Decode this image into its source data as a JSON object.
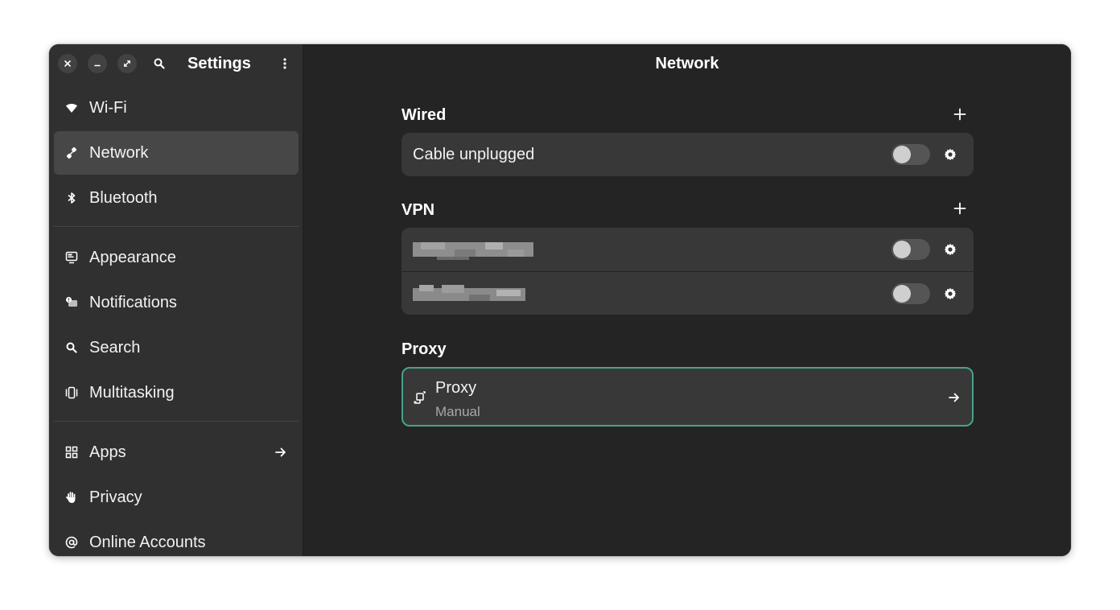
{
  "sidebar": {
    "title": "Settings",
    "items": [
      {
        "label": "Wi-Fi",
        "icon": "wifi-icon"
      },
      {
        "label": "Network",
        "icon": "network-icon",
        "active": true
      },
      {
        "label": "Bluetooth",
        "icon": "bluetooth-icon"
      },
      {
        "label": "Appearance",
        "icon": "appearance-icon"
      },
      {
        "label": "Notifications",
        "icon": "notifications-icon"
      },
      {
        "label": "Search",
        "icon": "search-icon"
      },
      {
        "label": "Multitasking",
        "icon": "multitasking-icon"
      },
      {
        "label": "Apps",
        "icon": "apps-icon"
      },
      {
        "label": "Privacy",
        "icon": "privacy-hand-icon"
      },
      {
        "label": "Online Accounts",
        "icon": "at-sign-icon"
      }
    ]
  },
  "main": {
    "title": "Network",
    "wired": {
      "label": "Wired",
      "rows": [
        {
          "label": "Cable unplugged",
          "enabled": false
        }
      ]
    },
    "vpn": {
      "label": "VPN",
      "rows": [
        {
          "enabled": false
        },
        {
          "enabled": false
        }
      ]
    },
    "proxy": {
      "label": "Proxy",
      "row_title": "Proxy",
      "row_subtitle": "Manual"
    }
  },
  "colors": {
    "sidebar_bg": "#303030",
    "main_bg": "#242424",
    "card_bg": "#383838",
    "active_item": "#474747",
    "focus_ring": "#4aa08a"
  }
}
